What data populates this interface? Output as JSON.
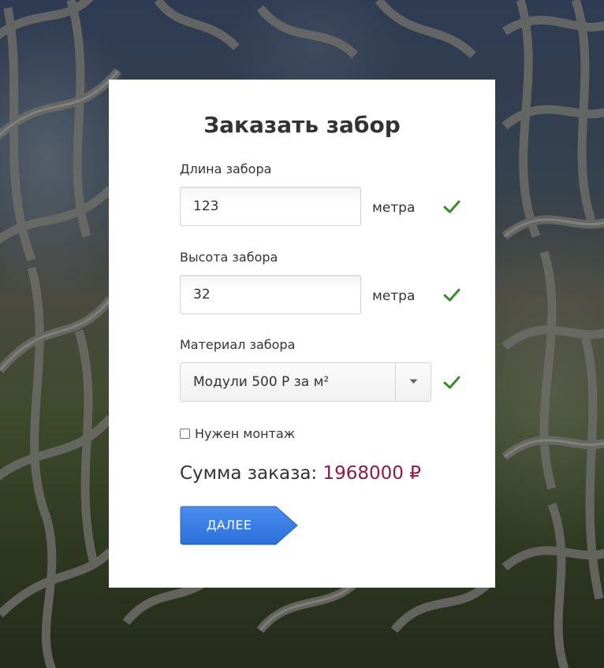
{
  "form": {
    "title": "Заказать забор",
    "length": {
      "label": "Длина забора",
      "value": "123",
      "unit": "метра",
      "valid": true
    },
    "height": {
      "label": "Высота забора",
      "value": "32",
      "unit": "метра",
      "valid": true
    },
    "material": {
      "label": "Материал забора",
      "selected": "Модули 500 Р за м²",
      "valid": true
    },
    "install": {
      "label": "Нужен монтаж",
      "checked": false
    },
    "total": {
      "label": "Сумма заказа:",
      "value": "1968000 ₽"
    },
    "next_label": "ДАЛЕЕ"
  },
  "colors": {
    "accent": "#3a7ee6",
    "check": "#3c8a2e",
    "total": "#8e1a45"
  }
}
